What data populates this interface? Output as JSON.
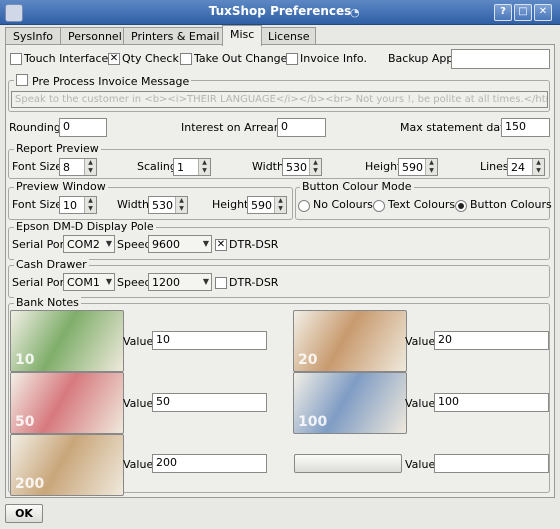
{
  "window": {
    "title": "TuxShop Preferences",
    "buttons": [
      "?",
      "□",
      "✕"
    ]
  },
  "tabs": [
    {
      "label": "SysInfo"
    },
    {
      "label": "Personnel"
    },
    {
      "label": "Printers & Email"
    },
    {
      "label": "Misc",
      "active": true
    },
    {
      "label": "License"
    }
  ],
  "options": {
    "touch_interface": {
      "label": "Touch Interface",
      "checked": false,
      "mark": ""
    },
    "qty_check": {
      "label": "Qty Check",
      "checked": true,
      "mark": "✕"
    },
    "take_out_change": {
      "label": "Take Out Change",
      "checked": false,
      "mark": ""
    },
    "invoice_info": {
      "label": "Invoice Info.",
      "checked": false,
      "mark": ""
    },
    "backup_app_label": "Backup App.",
    "backup_app_value": ""
  },
  "pre_process": {
    "label": "Pre Process Invoice Message",
    "checked": false,
    "mark": "",
    "message": "Speak to the customer in <b><i>THEIR LANGUAGE</i></b><br> Not yours !, be polite at all times.</html>"
  },
  "numbers": {
    "rounding_label": "Rounding",
    "rounding": "0",
    "interest_label": "Interest on Arrears",
    "interest": "0",
    "max_days_label": "Max statement days",
    "max_days": "150"
  },
  "report_preview": {
    "title": "Report Preview",
    "font_size_label": "Font Size",
    "font_size": "8",
    "scaling_label": "Scaling",
    "scaling": "1",
    "width_label": "Width",
    "width": "530",
    "height_label": "Height",
    "height": "590",
    "lines_label": "Lines",
    "lines": "24"
  },
  "preview_window": {
    "title": "Preview Window",
    "font_size_label": "Font Size",
    "font_size": "10",
    "width_label": "Width",
    "width": "530",
    "height_label": "Height",
    "height": "590"
  },
  "button_colour_mode": {
    "title": "Button Colour Mode",
    "options": [
      {
        "label": "No Colours",
        "selected": false
      },
      {
        "label": "Text Colours",
        "selected": false
      },
      {
        "label": "Button Colours",
        "selected": true
      }
    ]
  },
  "display_pole": {
    "title": "Epson DM-D Display Pole",
    "serial_port_label": "Serial Port",
    "serial_port": "COM2",
    "speed_label": "Speed",
    "speed": "9600",
    "dtr_label": "DTR-DSR",
    "dtr_checked": true,
    "dtr_mark": "✕"
  },
  "cash_drawer": {
    "title": "Cash Drawer",
    "serial_port_label": "Serial Port",
    "serial_port": "COM1",
    "speed_label": "Speed",
    "speed": "1200",
    "dtr_label": "DTR-DSR",
    "dtr_checked": false,
    "dtr_mark": ""
  },
  "bank_notes": {
    "title": "Bank Notes",
    "value_label": "Value",
    "notes": [
      {
        "value": "10",
        "denomination": "10",
        "color": "#7fae6a",
        "animal": "rhino"
      },
      {
        "value": "20",
        "denomination": "20",
        "color": "#c89a6e",
        "animal": "elephant"
      },
      {
        "value": "50",
        "denomination": "50",
        "color": "#d7797e",
        "animal": "lion"
      },
      {
        "value": "100",
        "denomination": "100",
        "color": "#7f9cc4",
        "animal": "buffalo"
      },
      {
        "value": "200",
        "denomination": "200",
        "color": "#c9a67a",
        "animal": "leopard"
      },
      {
        "value": "",
        "denomination": "",
        "color": "#d4d4d0",
        "animal": ""
      }
    ]
  },
  "ok_label": "OK",
  "colors": {
    "titlebar": "#3d6cb0",
    "pane": "#eeeeea",
    "background": "#e8e8e4"
  }
}
